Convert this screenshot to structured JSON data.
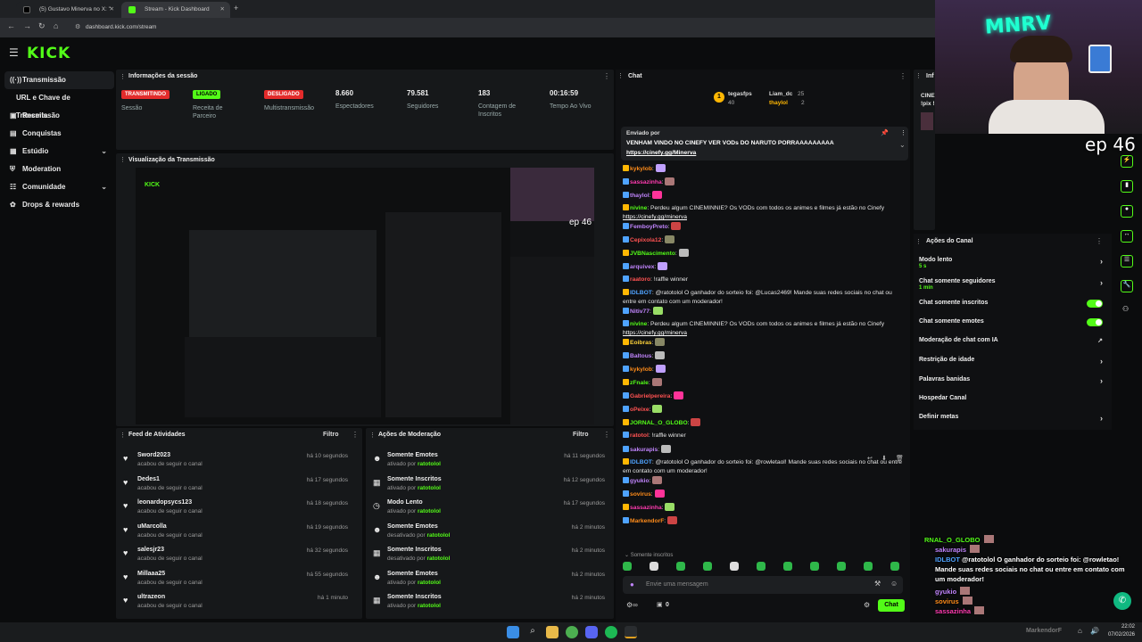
{
  "browser": {
    "tabs": [
      {
        "label": "(5) Gustavo Minerva no X: \"",
        "active": false
      },
      {
        "label": "Stream - Kick Dashboard",
        "active": true
      }
    ],
    "url": "dashboard.kick.com/stream"
  },
  "brand": {
    "logo": "KICK",
    "accent": "#53fc18"
  },
  "sidebar": {
    "items": [
      {
        "label": "Transmissão",
        "icon": "broadcast-icon",
        "active": true
      },
      {
        "label": "URL e Chave de Transmissão",
        "icon": "",
        "active": false
      },
      {
        "label": "Receita",
        "icon": "money-icon"
      },
      {
        "label": "Conquistas",
        "icon": "trophy-icon"
      },
      {
        "label": "Estúdio",
        "icon": "studio-icon",
        "expand": true
      },
      {
        "label": "Moderation",
        "icon": "shield-icon"
      },
      {
        "label": "Comunidade",
        "icon": "community-icon",
        "expand": true
      },
      {
        "label": "Drops & rewards",
        "icon": "gift-icon"
      }
    ]
  },
  "session": {
    "title": "Informações da sessão",
    "stats": [
      {
        "badge": "TRANSMITINDO",
        "badge_color": "#e32b2b",
        "label": "Sessão"
      },
      {
        "badge": "LIGADO",
        "badge_color": "#53fc18",
        "label": "Receita de Parceiro"
      },
      {
        "badge": "DESLIGADO",
        "badge_color": "#e32b2b",
        "label": "Multistransmissão"
      },
      {
        "value": "8.660",
        "label": "Espectadores"
      },
      {
        "value": "79.581",
        "label": "Seguidores"
      },
      {
        "value": "183",
        "label": "Contagem de Inscritos"
      },
      {
        "value": "00:16:59",
        "label": "Tempo Ao Vivo"
      }
    ]
  },
  "preview": {
    "title": "Visualização da Transmissão",
    "overlay_text": "ep 46"
  },
  "activity_feed": {
    "title": "Feed de Atividades",
    "filter": "Filtro",
    "rows": [
      {
        "name": "Sword2023",
        "sub": "acabou de seguir o canal",
        "time": "há 10 segundos"
      },
      {
        "name": "Dedes1",
        "sub": "acabou de seguir o canal",
        "time": "há 17 segundos"
      },
      {
        "name": "leonardopsycs123",
        "sub": "acabou de seguir o canal",
        "time": "há 18 segundos"
      },
      {
        "name": "uMarcolla",
        "sub": "acabou de seguir o canal",
        "time": "há 19 segundos"
      },
      {
        "name": "salesjr23",
        "sub": "acabou de seguir o canal",
        "time": "há 32 segundos"
      },
      {
        "name": "Millaaa25",
        "sub": "acabou de seguir o canal",
        "time": "há 55 segundos"
      },
      {
        "name": "ultrazeon",
        "sub": "acabou de seguir o canal",
        "time": "há 1 minuto"
      }
    ]
  },
  "mod_actions": {
    "title": "Ações de Moderação",
    "filter": "Filtro",
    "rows": [
      {
        "name": "Somente Emotes",
        "prefix": "ativado por",
        "by": "ratotolol",
        "time": "há 11 segundos",
        "icon": "emote-icon"
      },
      {
        "name": "Somente Inscritos",
        "prefix": "ativado por",
        "by": "ratotolol",
        "time": "há 12 segundos",
        "icon": "gift-icon"
      },
      {
        "name": "Modo Lento",
        "prefix": "ativado por",
        "by": "ratotolol",
        "time": "há 17 segundos",
        "icon": "clock-icon"
      },
      {
        "name": "Somente Emotes",
        "prefix": "desativado por",
        "by": "ratotolol",
        "time": "há 2 minutos",
        "icon": "emote-icon"
      },
      {
        "name": "Somente Inscritos",
        "prefix": "desativado por",
        "by": "ratotolol",
        "time": "há 2 minutos",
        "icon": "gift-icon"
      },
      {
        "name": "Somente Emotes",
        "prefix": "ativado por",
        "by": "ratotolol",
        "time": "há 2 minutos",
        "icon": "emote-icon"
      },
      {
        "name": "Somente Inscritos",
        "prefix": "ativado por",
        "by": "ratotolol",
        "time": "há 2 minutos",
        "icon": "gift-icon"
      }
    ]
  },
  "chat": {
    "title": "Chat",
    "top_gifters": [
      {
        "name": "tegasfps",
        "count": "40"
      },
      {
        "name": "Liam_dc",
        "count": "25"
      },
      {
        "name": "thaylol",
        "count": "2"
      }
    ],
    "pinned": {
      "label": "Enviado por",
      "text": "VENHAM VINDO NO CINEFY VER VODs DO NARUTO PORRAAAAAAAAA",
      "link": "https://cinefy.gg/Minerva"
    },
    "messages": [
      {
        "user": "kykylob",
        "color": "#ff8c1a",
        "text": ""
      },
      {
        "user": "sassazinha",
        "color": "#ff3bb0",
        "text": ""
      },
      {
        "user": "thaylol",
        "color": "#c084fc",
        "text": ""
      },
      {
        "user": "nivine",
        "color": "#53fc18",
        "text": "Perdeu algum CINEMINNIE? Os VODs com todos os animes e filmes já estão no Cinefy",
        "link": "https://cinefy.gg/minerva"
      },
      {
        "user": "FemboyPreto",
        "color": "#c084fc",
        "text": ""
      },
      {
        "user": "Cepixola12",
        "color": "#ff5252",
        "text": ""
      },
      {
        "user": "JVBNascimento",
        "color": "#53fc18",
        "text": ""
      },
      {
        "user": "arquivex",
        "color": "#c084fc",
        "text": ""
      },
      {
        "user": "raatoro",
        "color": "#ff5252",
        "text": "!raffle winner"
      },
      {
        "user": "IDLBOT",
        "color": "#4fa3ff",
        "text": "@ratotolol O ganhador do sorteio foi: @Lucas2469! Mande suas redes sociais no chat ou entre em contato com um moderador!"
      },
      {
        "user": "Nitiv77",
        "color": "#c084fc",
        "text": ""
      },
      {
        "user": "nivine",
        "color": "#53fc18",
        "text": "Perdeu algum CINEMINNIE? Os VODs com todos os animes e filmes já estão no Cinefy",
        "link": "https://cinefy.gg/minerva"
      },
      {
        "user": "Eoibras",
        "color": "#ffd43b",
        "text": ""
      },
      {
        "user": "Baltous",
        "color": "#c084fc",
        "text": ""
      },
      {
        "user": "kykylob",
        "color": "#ff8c1a",
        "text": ""
      },
      {
        "user": "zFnale",
        "color": "#53fc18",
        "text": ""
      },
      {
        "user": "Gabrielpereira",
        "color": "#ff5252",
        "text": ""
      },
      {
        "user": "oPeixe",
        "color": "#ff5252",
        "text": ""
      },
      {
        "user": "JORNAL_O_GLOBO",
        "color": "#53fc18",
        "text": ""
      },
      {
        "user": "ratotol",
        "color": "#ff5252",
        "text": "!raffle winner"
      },
      {
        "user": "sakurapis",
        "color": "#c084fc",
        "text": ""
      },
      {
        "user": "IDLBOT",
        "color": "#4fa3ff",
        "text": "@ratotolol O ganhador do sorteio foi: @rowletaol! Mande suas redes sociais no chat ou entre em contato com um moderador!"
      },
      {
        "user": "gyukio",
        "color": "#c084fc",
        "text": ""
      },
      {
        "user": "sovirus",
        "color": "#ff8c1a",
        "text": ""
      },
      {
        "user": "sassazinha",
        "color": "#ff3bb0",
        "text": ""
      },
      {
        "user": "MarkendorF",
        "color": "#ff8c1a",
        "text": ""
      }
    ],
    "mode_label": "Somente inscritos",
    "input_placeholder": "Envie uma mensagem",
    "send_label": "Chat",
    "footer_count": "0"
  },
  "channel_actions": {
    "title": "Ações do Canal",
    "rows": [
      {
        "label": "Modo lento",
        "sub": "5 s",
        "control": "chevron"
      },
      {
        "label": "Chat somente seguidores",
        "sub": "1 min",
        "control": "chevron"
      },
      {
        "label": "Chat somente inscritos",
        "sub": "",
        "control": "toggle"
      },
      {
        "label": "Chat somente emotes",
        "sub": "",
        "control": "toggle"
      },
      {
        "label": "Moderação de chat com IA",
        "sub": "",
        "control": "external"
      },
      {
        "label": "Restrição de idade",
        "sub": "",
        "control": "chevron"
      },
      {
        "label": "Palavras banidas",
        "sub": "",
        "control": "chevron"
      },
      {
        "label": "Hospedar Canal",
        "sub": "",
        "control": "none"
      },
      {
        "label": "Definir metas",
        "sub": "",
        "control": "chevron"
      }
    ]
  },
  "cam": {
    "sign": "MNRV",
    "episode": "ep 46"
  },
  "overlay_chat": [
    {
      "user": "RNAL_O_GLOBO",
      "color": "#53fc18",
      "text": ""
    },
    {
      "user": "sakurapis",
      "color": "#c084fc",
      "text": ""
    },
    {
      "user": "IDLBOT",
      "color": "#4fa3ff",
      "text": "@ratotolol O ganhador do sorteio foi: @rowletao! Mande suas redes sociais no chat ou entre em contato com um moderador!"
    },
    {
      "user": "gyukio",
      "color": "#c084fc",
      "text": ""
    },
    {
      "user": "sovirus",
      "color": "#ff8c1a",
      "text": ""
    },
    {
      "user": "sassazinha",
      "color": "#ff3bb0",
      "text": ""
    }
  ],
  "info_panel": {
    "title": "Inf",
    "text1": "CINE",
    "text2": "!pix !"
  },
  "taskbar": {
    "clock": "22:02",
    "date": "07/02/2026",
    "tray_user": "MarkendorF"
  }
}
